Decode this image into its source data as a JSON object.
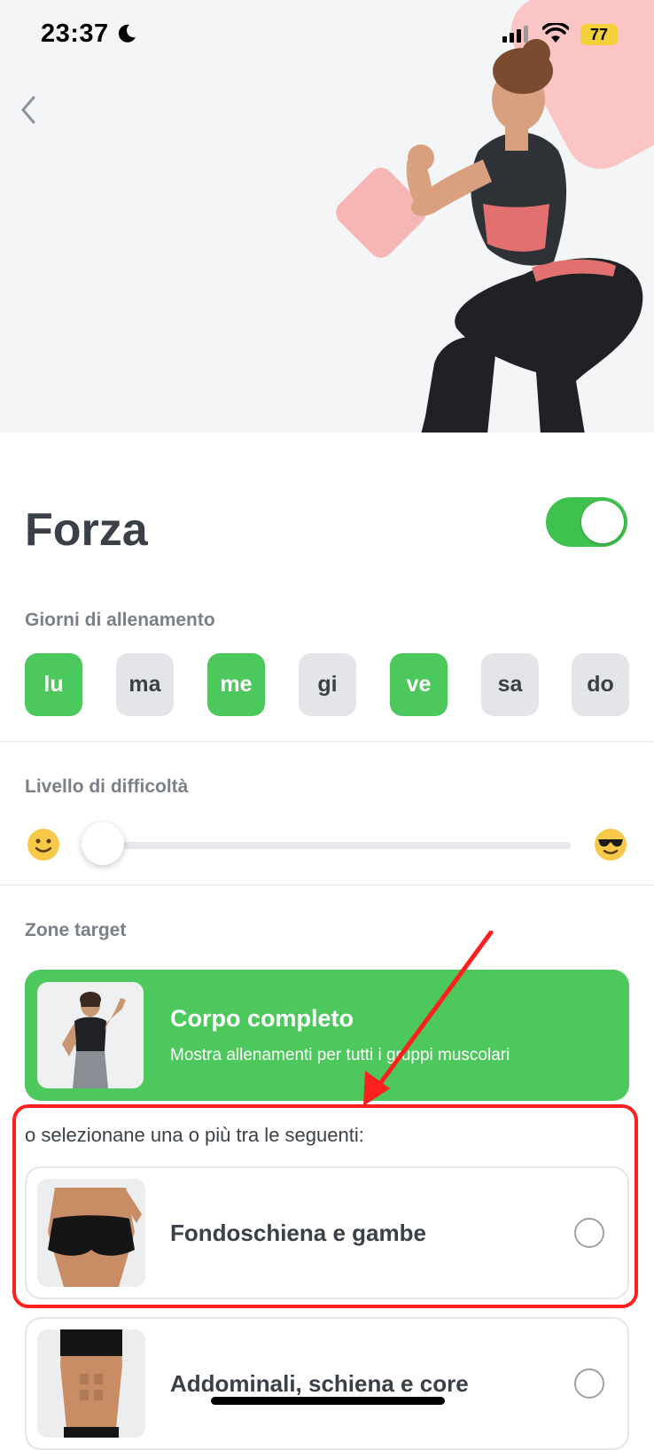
{
  "status": {
    "time": "23:37",
    "battery": "77"
  },
  "header": {
    "title": "Forza"
  },
  "training_days": {
    "label": "Giorni di allenamento",
    "days": [
      {
        "label": "lu",
        "selected": true
      },
      {
        "label": "ma",
        "selected": false
      },
      {
        "label": "me",
        "selected": true
      },
      {
        "label": "gi",
        "selected": false
      },
      {
        "label": "ve",
        "selected": true
      },
      {
        "label": "sa",
        "selected": false
      },
      {
        "label": "do",
        "selected": false
      }
    ]
  },
  "difficulty": {
    "label": "Livello di difficoltà",
    "value": 0
  },
  "target_zones": {
    "label": "Zone target",
    "full_body": {
      "title": "Corpo completo",
      "subtitle": "Mostra allenamenti per tutti i gruppi muscolari"
    },
    "hint": "o selezionane una o più tra le seguenti:",
    "zones": [
      {
        "label": "Fondoschiena e gambe",
        "selected": false
      },
      {
        "label": "Addominali, schiena e core",
        "selected": false
      }
    ]
  },
  "colors": {
    "accent": "#4cc85c",
    "highlight": "#ff1f1f",
    "deco": "#fbc5c5"
  }
}
